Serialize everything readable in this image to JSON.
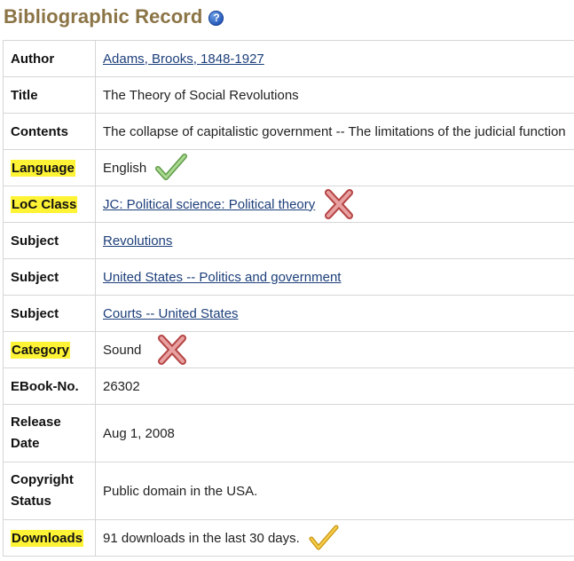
{
  "page": {
    "title": "Bibliographic Record",
    "help_icon": "help-icon"
  },
  "record": {
    "rows": [
      {
        "label": "Author",
        "value": "Adams, Brooks, 1848-1927",
        "link": true,
        "highlight": false,
        "mark": null
      },
      {
        "label": "Title",
        "value": "The Theory of Social Revolutions",
        "link": false,
        "highlight": false,
        "mark": null
      },
      {
        "label": "Contents",
        "value": "The collapse of capitalistic government -- The limitations of the judicial function",
        "link": false,
        "highlight": false,
        "mark": null
      },
      {
        "label": "Language",
        "value": "English",
        "link": false,
        "highlight": true,
        "mark": "green-check"
      },
      {
        "label": "LoC Class",
        "value": "JC: Political science: Political theory",
        "link": true,
        "highlight": true,
        "mark": "red-x"
      },
      {
        "label": "Subject",
        "value": "Revolutions",
        "link": true,
        "highlight": false,
        "mark": null
      },
      {
        "label": "Subject",
        "value": "United States -- Politics and government",
        "link": true,
        "highlight": false,
        "mark": null
      },
      {
        "label": "Subject",
        "value": "Courts -- United States",
        "link": true,
        "highlight": false,
        "mark": null
      },
      {
        "label": "Category",
        "value": "Sound",
        "link": false,
        "highlight": true,
        "mark": "red-x"
      },
      {
        "label": "EBook-No.",
        "value": "26302",
        "link": false,
        "highlight": false,
        "mark": null
      },
      {
        "label": "Release Date",
        "value": "Aug 1, 2008",
        "link": false,
        "highlight": false,
        "mark": null
      },
      {
        "label": "Copyright Status",
        "value": "Public domain in the USA.",
        "link": false,
        "highlight": false,
        "mark": null
      },
      {
        "label": "Downloads",
        "value": "91 downloads in the last 30 days.",
        "link": false,
        "highlight": true,
        "mark": "yellow-check"
      }
    ]
  },
  "colors": {
    "title": "#8b7446",
    "link": "#1d3f7a",
    "highlight": "#fff335",
    "green_check": "#8fc47a",
    "red_x": "#c85a5a",
    "yellow_check": "#e3ad14"
  }
}
